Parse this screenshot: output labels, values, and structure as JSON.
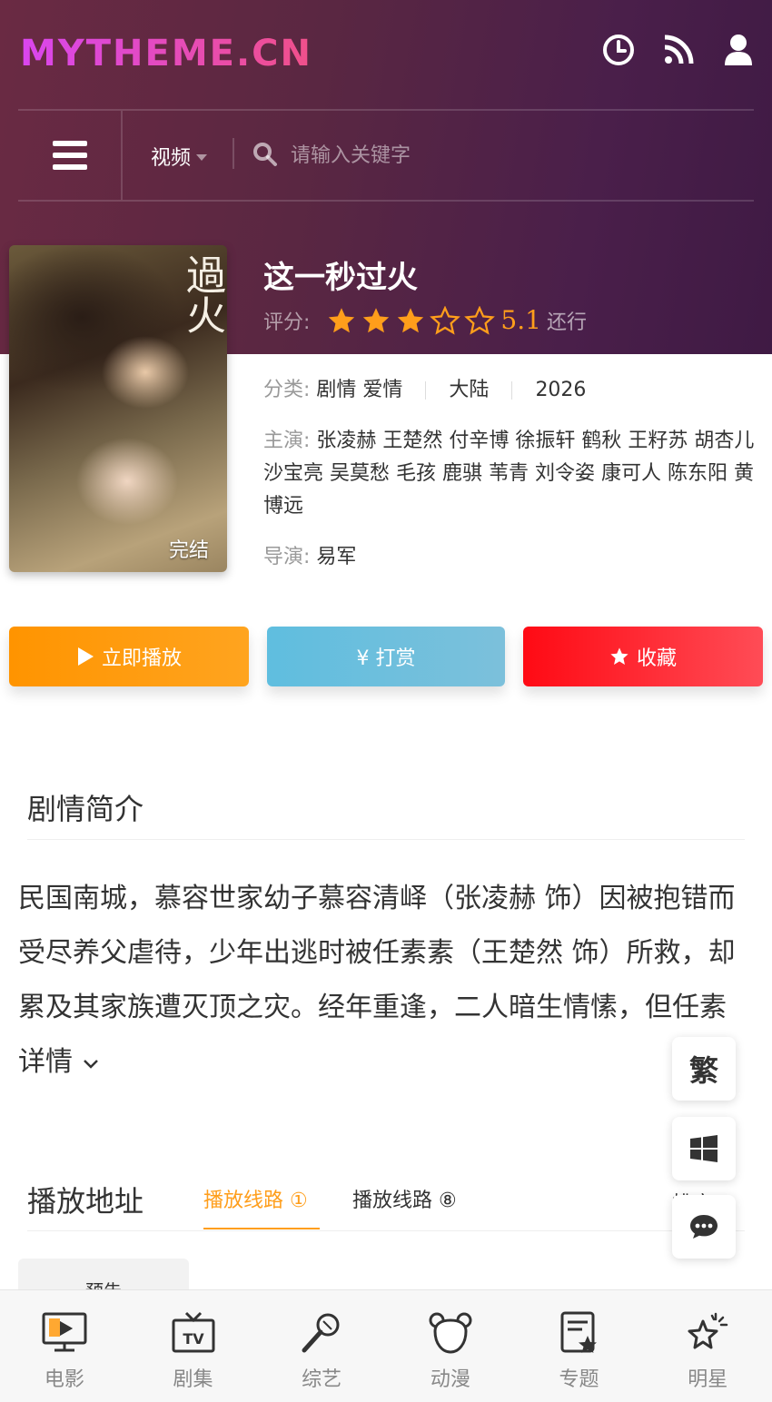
{
  "header": {
    "logo": "MYTHEME.CN",
    "icons": [
      "history-icon",
      "rss-icon",
      "user-icon"
    ]
  },
  "nav": {
    "category": "视频",
    "search_placeholder": "请输入关键字"
  },
  "video": {
    "title": "这一秒过火",
    "rating_label": "评分:",
    "rating_stars": 3,
    "rating_max": 5,
    "score": "5.1",
    "rating_suffix": "还行",
    "poster_calligraphy": "過火",
    "poster_badge": "完结",
    "type_label": "分类:",
    "genres": "剧情 爱情",
    "region": "大陆",
    "year": "2026",
    "cast_label": "主演:",
    "cast": "张凌赫 王楚然 付辛博 徐振轩 鹤秋 王籽苏 胡杏儿 沙宝亮 吴莫愁 毛孩 鹿骐 苇青 刘令姿 康可人 陈东阳 黄博远",
    "director_label": "导演:",
    "director": "易军"
  },
  "actions": {
    "play": "立即播放",
    "reward": "¥ 打赏",
    "favorite": "收藏"
  },
  "synopsis": {
    "title": "剧情简介",
    "text": "民国南城，慕容世家幼子慕容清峄（张凌赫 饰）因被抱错而受尽养父虐待，少年出逃时被任素素（王楚然 饰）所救，却累及其家族遭灭顶之灾。经年重逢，二人暗生情愫，但任素",
    "more": "详情"
  },
  "play": {
    "title": "播放地址",
    "tabs": [
      {
        "label": "播放线路 ①"
      },
      {
        "label": "播放线路 ⑧"
      }
    ],
    "sort_label": "排序",
    "episodes": [
      "预告"
    ]
  },
  "floating": {
    "traditional": "繁"
  },
  "bottom_nav": [
    {
      "label": "电影",
      "icon": "movie-icon"
    },
    {
      "label": "剧集",
      "icon": "tv-icon"
    },
    {
      "label": "综艺",
      "icon": "microphone-icon"
    },
    {
      "label": "动漫",
      "icon": "anime-bear-icon"
    },
    {
      "label": "专题",
      "icon": "topic-icon"
    },
    {
      "label": "明星",
      "icon": "star-icon"
    }
  ],
  "colors": {
    "accent": "#ff9e1b",
    "play": "#ff9400",
    "reward": "#5fbedf",
    "favorite": "#ff0a14"
  }
}
